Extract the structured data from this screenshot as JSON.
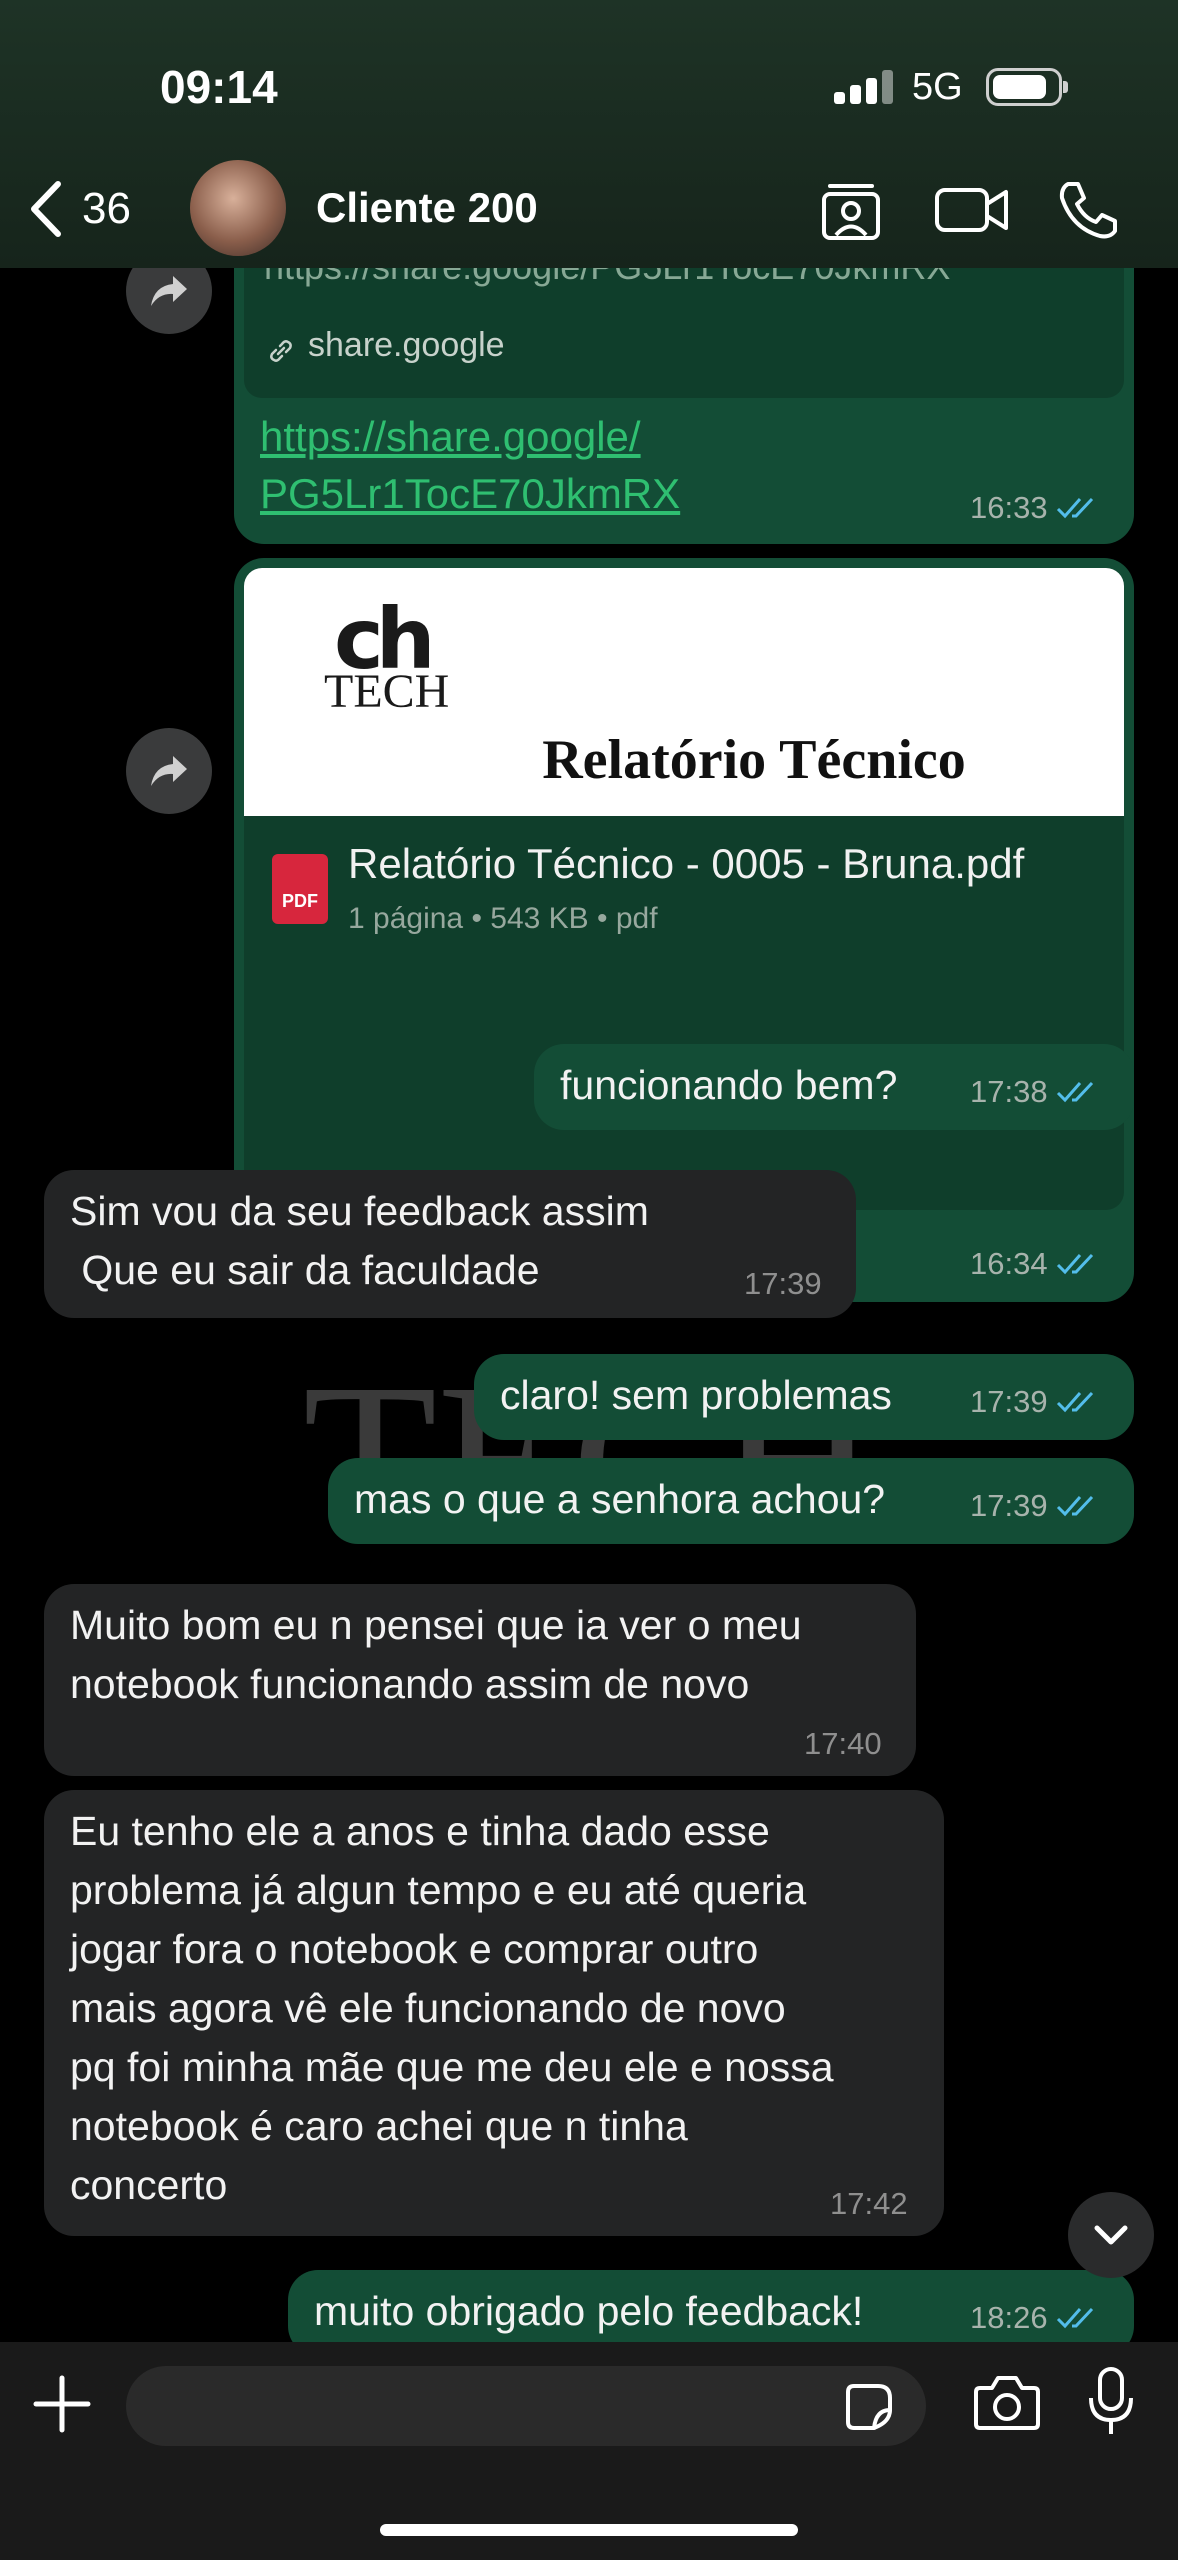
{
  "status_bar": {
    "time": "09:14",
    "network": "5G",
    "battery_level": 0.85
  },
  "header": {
    "back_count": "36",
    "contact_name": "Cliente 200",
    "icons": [
      "back-chevron-icon",
      "contact-card-icon",
      "video-call-icon",
      "phone-icon"
    ]
  },
  "watermark": {
    "logo_mark": "ch",
    "logo_text": "TECH"
  },
  "messages": [
    {
      "direction": "out",
      "kind": "link",
      "preview_url": "https://share.google/PG5Lr1TocE70JkmRX",
      "preview_domain": "share.google",
      "text": "https://share.google/\nPG5Lr1TocE70JkmRX",
      "time": "16:33",
      "read": true
    },
    {
      "direction": "out",
      "kind": "document",
      "preview_logo_mark": "ch",
      "preview_logo_text": "TECH",
      "preview_title": "Relatório Técnico",
      "file_name": "Relatório Técnico - 0005 - Bruna.pdf",
      "file_info": "1 página • 543 KB • pdf",
      "file_badge": "PDF",
      "time": "16:34",
      "read": true
    },
    {
      "direction": "out",
      "text": "funcionando bem?",
      "time": "17:38",
      "read": true
    },
    {
      "direction": "in",
      "text": "Sim vou da seu feedback assim\n Que eu sair da faculdade",
      "time": "17:39"
    },
    {
      "direction": "out",
      "text": "claro! sem problemas",
      "time": "17:39",
      "read": true
    },
    {
      "direction": "out",
      "text": "mas o que a senhora achou?",
      "time": "17:39",
      "read": true
    },
    {
      "direction": "in",
      "text": "Muito bom eu n pensei que ia ver o meu\nnotebook funcionando assim de novo",
      "time": "17:40"
    },
    {
      "direction": "in",
      "text": "Eu tenho ele a anos e tinha dado esse\nproblema já algun tempo e eu até queria\njogar fora o notebook e comprar outro\nmais agora vê ele funcionando de novo\npq foi minha mãe que me deu ele e nossa\nnotebook é caro achei que n tinha\nconcerto",
      "time": "17:42"
    },
    {
      "direction": "out",
      "text": "muito obrigado pelo feedback!",
      "time": "18:26",
      "read": true
    }
  ],
  "colors": {
    "outgoing_bubble": "#134d36",
    "incoming_bubble": "#232425",
    "link": "#2fbf71",
    "read_ticks": "#53bdeb",
    "header_bg": "#1e3326"
  },
  "composer": {
    "icons": [
      "plus-icon",
      "sticker-icon",
      "camera-icon",
      "microphone-icon"
    ]
  }
}
